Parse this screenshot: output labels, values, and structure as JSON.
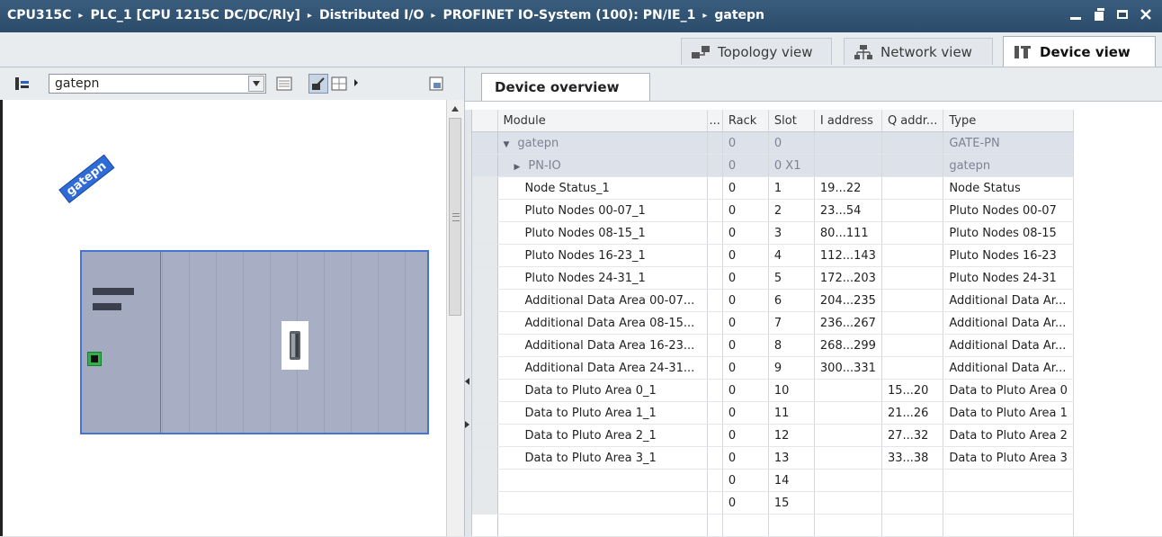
{
  "titlebar": {
    "breadcrumbs": [
      "CPU315C",
      "PLC_1 [CPU 1215C DC/DC/Rly]",
      "Distributed I/O",
      "PROFINET IO-System (100): PN/IE_1",
      "gatepn"
    ],
    "separator": "▸"
  },
  "view_tabs": [
    {
      "label": "Topology view",
      "icon": "topology-icon",
      "active": false
    },
    {
      "label": "Network view",
      "icon": "network-icon",
      "active": false
    },
    {
      "label": "Device view",
      "icon": "device-icon",
      "active": true
    }
  ],
  "left_toolbar": {
    "device_select_value": "gatepn"
  },
  "device": {
    "label": "gatepn"
  },
  "overview": {
    "tab_label": "Device overview",
    "columns": [
      "Module",
      "...",
      "Rack",
      "Slot",
      "I address",
      "Q addr...",
      "Type"
    ],
    "rows": [
      {
        "module": "gatepn",
        "rack": "0",
        "slot": "0",
        "i_address": "",
        "q_address": "",
        "type": "GATE-PN",
        "header": true,
        "indent": 0,
        "caret": "▼"
      },
      {
        "module": "PN-IO",
        "rack": "0",
        "slot": "0 X1",
        "i_address": "",
        "q_address": "",
        "type": "gatepn",
        "header": true,
        "indent": 1,
        "caret": "▶"
      },
      {
        "module": "Node Status_1",
        "rack": "0",
        "slot": "1",
        "i_address": "19...22",
        "q_address": "",
        "type": "Node Status"
      },
      {
        "module": "Pluto Nodes 00-07_1",
        "rack": "0",
        "slot": "2",
        "i_address": "23...54",
        "q_address": "",
        "type": "Pluto Nodes 00-07"
      },
      {
        "module": "Pluto Nodes 08-15_1",
        "rack": "0",
        "slot": "3",
        "i_address": "80...111",
        "q_address": "",
        "type": "Pluto Nodes 08-15"
      },
      {
        "module": "Pluto Nodes 16-23_1",
        "rack": "0",
        "slot": "4",
        "i_address": "112...143",
        "q_address": "",
        "type": "Pluto Nodes 16-23"
      },
      {
        "module": "Pluto Nodes 24-31_1",
        "rack": "0",
        "slot": "5",
        "i_address": "172...203",
        "q_address": "",
        "type": "Pluto Nodes 24-31"
      },
      {
        "module": "Additional Data Area 00-07...",
        "rack": "0",
        "slot": "6",
        "i_address": "204...235",
        "q_address": "",
        "type": "Additional Data Ar..."
      },
      {
        "module": "Additional Data Area 08-15...",
        "rack": "0",
        "slot": "7",
        "i_address": "236...267",
        "q_address": "",
        "type": "Additional Data Ar..."
      },
      {
        "module": "Additional Data Area 16-23...",
        "rack": "0",
        "slot": "8",
        "i_address": "268...299",
        "q_address": "",
        "type": "Additional Data Ar..."
      },
      {
        "module": "Additional Data Area 24-31...",
        "rack": "0",
        "slot": "9",
        "i_address": "300...331",
        "q_address": "",
        "type": "Additional Data Ar..."
      },
      {
        "module": "Data to Pluto Area 0_1",
        "rack": "0",
        "slot": "10",
        "i_address": "",
        "q_address": "15...20",
        "type": "Data to Pluto Area 0"
      },
      {
        "module": "Data to Pluto Area 1_1",
        "rack": "0",
        "slot": "11",
        "i_address": "",
        "q_address": "21...26",
        "type": "Data to Pluto Area 1"
      },
      {
        "module": "Data to Pluto Area 2_1",
        "rack": "0",
        "slot": "12",
        "i_address": "",
        "q_address": "27...32",
        "type": "Data to Pluto Area 2"
      },
      {
        "module": "Data to Pluto Area 3_1",
        "rack": "0",
        "slot": "13",
        "i_address": "",
        "q_address": "33...38",
        "type": "Data to Pluto Area 3"
      },
      {
        "module": "",
        "rack": "0",
        "slot": "14",
        "i_address": "",
        "q_address": "",
        "type": ""
      },
      {
        "module": "",
        "rack": "0",
        "slot": "15",
        "i_address": "",
        "q_address": "",
        "type": ""
      },
      {
        "module": "",
        "rack": "",
        "slot": "",
        "i_address": "",
        "q_address": "",
        "type": "",
        "empty": true
      }
    ]
  },
  "colors": {
    "titlebar": "#2b4b69",
    "device_label": "#2f6bd6",
    "rack_border": "#4574d3",
    "port": "#2fb04a"
  }
}
